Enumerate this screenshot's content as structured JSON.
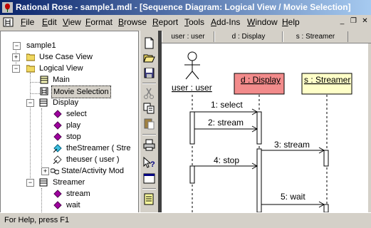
{
  "window": {
    "title": "Rational Rose - sample1.mdl - [Sequence Diagram: Logical View / Movie Selection]",
    "controls": [
      "minimize",
      "restore",
      "close"
    ]
  },
  "menu": {
    "items": [
      "File",
      "Edit",
      "View",
      "Format",
      "Browse",
      "Report",
      "Tools",
      "Add-Ins",
      "Window",
      "Help"
    ]
  },
  "tree": {
    "root": "sample1",
    "use_case_view": "Use Case View",
    "logical_view": "Logical View",
    "main": "Main",
    "movie_selection": "Movie Selection",
    "display": "Display",
    "display_ops": [
      "select",
      "play",
      "stop"
    ],
    "display_attrs": [
      "theStreamer ( Stre",
      "theuser ( user )"
    ],
    "state_activity": "State/Activity Mod",
    "streamer": "Streamer",
    "streamer_ops": [
      "stream",
      "wait"
    ]
  },
  "toolbox": {
    "tools": [
      "new-icon",
      "open-icon",
      "save-icon",
      "cut-icon",
      "copy-icon",
      "paste-icon",
      "print-icon",
      "context-help-icon",
      "view-doc-icon",
      "browse-icon"
    ]
  },
  "diagram": {
    "tab_headers": [
      "user : user",
      "d : Display",
      "s : Streamer"
    ],
    "actor_label": "user : user",
    "objects": [
      "d : Display",
      "s : Streamer"
    ],
    "messages": [
      {
        "num": "1",
        "text": "select",
        "label": "1: select"
      },
      {
        "num": "2",
        "text": "stream",
        "label": "2: stream"
      },
      {
        "num": "3",
        "text": "stream",
        "label": "3: stream"
      },
      {
        "num": "4",
        "text": "stop",
        "label": "4: stop"
      },
      {
        "num": "5",
        "text": "wait",
        "label": "5: wait"
      }
    ],
    "colors": {
      "display_fill": "#f28b8b",
      "streamer_fill": "#ffffc8"
    }
  },
  "status": {
    "text": "For Help, press F1"
  }
}
